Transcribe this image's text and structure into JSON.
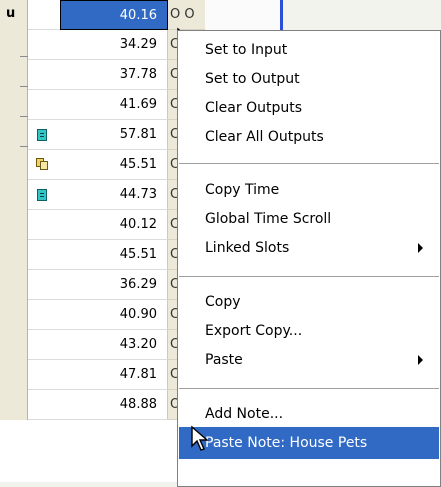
{
  "grid": {
    "header_left_label": "u",
    "rows": [
      {
        "value": "40.16",
        "flag": "O  O",
        "icon": ""
      },
      {
        "value": "34.29",
        "flag": "C",
        "icon": ""
      },
      {
        "value": "37.78",
        "flag": "C",
        "icon": ""
      },
      {
        "value": "41.69",
        "flag": "C",
        "icon": ""
      },
      {
        "value": "57.81",
        "flag": "C",
        "icon": "note-icon"
      },
      {
        "value": "45.51",
        "flag": "C",
        "icon": "pages-icon"
      },
      {
        "value": "44.73",
        "flag": "C",
        "icon": "note-icon"
      },
      {
        "value": "40.12",
        "flag": "C",
        "icon": ""
      },
      {
        "value": "45.51",
        "flag": "C",
        "icon": ""
      },
      {
        "value": "36.29",
        "flag": "C",
        "icon": ""
      },
      {
        "value": "40.90",
        "flag": "C",
        "icon": ""
      },
      {
        "value": "43.20",
        "flag": "C",
        "icon": ""
      },
      {
        "value": "47.81",
        "flag": "C",
        "icon": ""
      },
      {
        "value": "48.88",
        "flag": "O  O",
        "icon": ""
      }
    ]
  },
  "context_menu": {
    "items": [
      {
        "label": "Set to Input"
      },
      {
        "label": "Set to Output"
      },
      {
        "label": "Clear Outputs"
      },
      {
        "label": "Clear All Outputs"
      },
      {
        "label": "Copy Time"
      },
      {
        "label": "Global Time Scroll"
      },
      {
        "label": "Linked Slots",
        "submenu": true
      },
      {
        "label": "Copy"
      },
      {
        "label": "Export Copy..."
      },
      {
        "label": "Paste",
        "submenu": true
      },
      {
        "label": "Add Note..."
      },
      {
        "label": "Paste Note: House Pets",
        "highlighted": true
      }
    ]
  },
  "colors": {
    "selection": "#316ac5",
    "menu_bg": "#ffffff",
    "grid_bg": "#ffffff",
    "chrome": "#ece9d8",
    "accent_strip": "#2a4fd6"
  },
  "icons": [
    "note-icon",
    "pages-icon",
    "arrow-cursor-icon",
    "submenu-arrow-icon"
  ]
}
